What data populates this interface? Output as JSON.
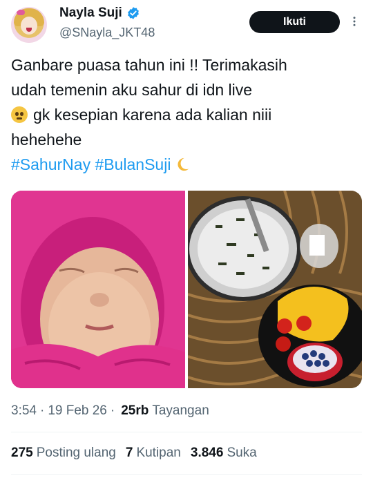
{
  "author": {
    "display_name": "Nayla Suji",
    "handle": "@SNayla_JKT48",
    "verified_icon": "verified-badge-icon",
    "avatar": "avatar-image"
  },
  "header": {
    "follow_label": "Ikuti",
    "more_icon": "more-options-icon"
  },
  "tweet": {
    "line1": "Ganbare puasa tahun ini !!  Terimakasih",
    "line2": "udah temenin aku sahur di idn live",
    "line3": "gk kesepian karena ada kalian niii",
    "line4": "hehehehe",
    "hashtag1": "#SahurNay",
    "hashtag2": "#BulanSuji",
    "emoji1": "pleading-face-emoji",
    "emoji2": "crescent-moon-emoji"
  },
  "media": [
    {
      "name": "photo-baby",
      "description_icon": "baby-photo"
    },
    {
      "name": "photo-food",
      "description_icon": "food-photo"
    }
  ],
  "meta": {
    "time": "3:54",
    "date": "19 Feb 26",
    "views_count": "25rb",
    "views_label": "Tayangan"
  },
  "stats": {
    "reposts_count": "275",
    "reposts_label": "Posting ulang",
    "quotes_count": "7",
    "quotes_label": "Kutipan",
    "likes_count": "3.846",
    "likes_label": "Suka"
  },
  "colors": {
    "link": "#1d9bf0",
    "text": "#0f1419",
    "secondary": "#536471",
    "button": "#0f1419"
  }
}
